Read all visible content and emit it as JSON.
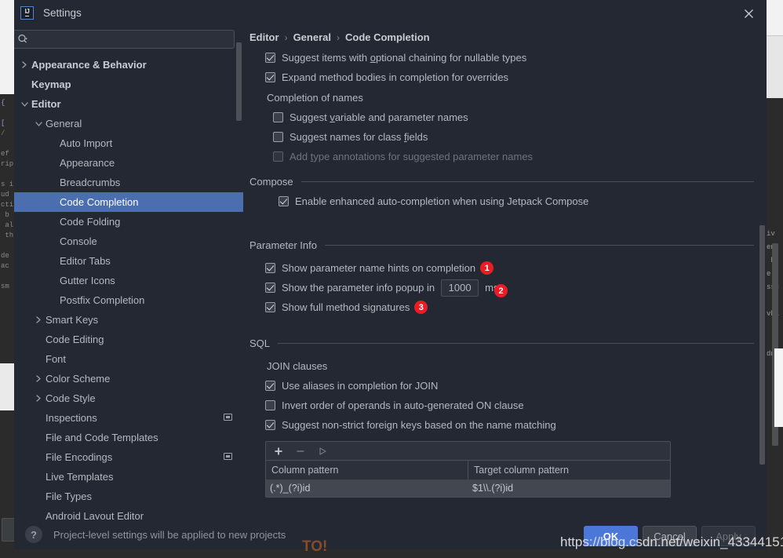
{
  "window": {
    "title": "Settings",
    "logo_text": "IJ",
    "close_icon": "close-icon"
  },
  "search": {
    "value": "",
    "placeholder": "",
    "icon": "search-icon"
  },
  "tree": {
    "items": [
      {
        "label": "Appearance & Behavior",
        "level": 0,
        "twisty": "collapsed",
        "bold": true,
        "selected": false,
        "badge": false
      },
      {
        "label": "Keymap",
        "level": 0,
        "twisty": "none",
        "bold": true,
        "selected": false,
        "badge": false
      },
      {
        "label": "Editor",
        "level": 0,
        "twisty": "expanded",
        "bold": true,
        "selected": false,
        "badge": false
      },
      {
        "label": "General",
        "level": 1,
        "twisty": "expanded",
        "bold": false,
        "selected": false,
        "badge": false
      },
      {
        "label": "Auto Import",
        "level": 2,
        "twisty": "none",
        "bold": false,
        "selected": false,
        "badge": false
      },
      {
        "label": "Appearance",
        "level": 2,
        "twisty": "none",
        "bold": false,
        "selected": false,
        "badge": false
      },
      {
        "label": "Breadcrumbs",
        "level": 2,
        "twisty": "none",
        "bold": false,
        "selected": false,
        "badge": false
      },
      {
        "label": "Code Completion",
        "level": 2,
        "twisty": "none",
        "bold": false,
        "selected": true,
        "badge": false
      },
      {
        "label": "Code Folding",
        "level": 2,
        "twisty": "none",
        "bold": false,
        "selected": false,
        "badge": false
      },
      {
        "label": "Console",
        "level": 2,
        "twisty": "none",
        "bold": false,
        "selected": false,
        "badge": false
      },
      {
        "label": "Editor Tabs",
        "level": 2,
        "twisty": "none",
        "bold": false,
        "selected": false,
        "badge": false
      },
      {
        "label": "Gutter Icons",
        "level": 2,
        "twisty": "none",
        "bold": false,
        "selected": false,
        "badge": false
      },
      {
        "label": "Postfix Completion",
        "level": 2,
        "twisty": "none",
        "bold": false,
        "selected": false,
        "badge": false
      },
      {
        "label": "Smart Keys",
        "level": 1,
        "twisty": "collapsed",
        "bold": false,
        "selected": false,
        "badge": false
      },
      {
        "label": "Code Editing",
        "level": 1,
        "twisty": "none",
        "bold": false,
        "selected": false,
        "badge": false
      },
      {
        "label": "Font",
        "level": 1,
        "twisty": "none",
        "bold": false,
        "selected": false,
        "badge": false
      },
      {
        "label": "Color Scheme",
        "level": 1,
        "twisty": "collapsed",
        "bold": false,
        "selected": false,
        "badge": false
      },
      {
        "label": "Code Style",
        "level": 1,
        "twisty": "collapsed",
        "bold": false,
        "selected": false,
        "badge": false
      },
      {
        "label": "Inspections",
        "level": 1,
        "twisty": "none",
        "bold": false,
        "selected": false,
        "badge": true
      },
      {
        "label": "File and Code Templates",
        "level": 1,
        "twisty": "none",
        "bold": false,
        "selected": false,
        "badge": false
      },
      {
        "label": "File Encodings",
        "level": 1,
        "twisty": "none",
        "bold": false,
        "selected": false,
        "badge": true
      },
      {
        "label": "Live Templates",
        "level": 1,
        "twisty": "none",
        "bold": false,
        "selected": false,
        "badge": false
      },
      {
        "label": "File Types",
        "level": 1,
        "twisty": "none",
        "bold": false,
        "selected": false,
        "badge": false
      },
      {
        "label": "Android Layout Editor",
        "level": 1,
        "twisty": "none",
        "bold": false,
        "selected": false,
        "badge": false
      }
    ]
  },
  "breadcrumb": {
    "part1": "Editor",
    "part2": "General",
    "part3": "Code Completion",
    "separator": "›"
  },
  "content": {
    "top_options": [
      {
        "label_pre": "Suggest items with ",
        "mnemonic": "o",
        "label_post": "ptional chaining for nullable types",
        "checked": true,
        "disabled": false
      },
      {
        "label_pre": "Expand method bodies in completion for overrides",
        "mnemonic": "",
        "label_post": "",
        "checked": true,
        "disabled": false
      }
    ],
    "completion_of_names": {
      "title": "Completion of names",
      "options": [
        {
          "label_pre": "Suggest ",
          "mnemonic": "v",
          "label_post": "ariable and parameter names",
          "checked": false,
          "disabled": false
        },
        {
          "label_pre": "Suggest names for class ",
          "mnemonic": "f",
          "label_post": "ields",
          "checked": false,
          "disabled": false
        },
        {
          "label_pre": "Add ",
          "mnemonic": "t",
          "label_post": "ype annotations for suggested parameter names",
          "checked": false,
          "disabled": true
        }
      ]
    },
    "compose": {
      "title": "Compose",
      "options": [
        {
          "label_pre": "Enable enhanced auto-completion when using Jetpack Compose",
          "mnemonic": "",
          "label_post": "",
          "checked": true,
          "disabled": false
        }
      ]
    },
    "parameter_info": {
      "title": "Parameter Info",
      "opt1_label": "Show parameter name hints on completion",
      "opt1_checked": true,
      "opt1_badge": "1",
      "opt2_label": "Show the parameter info popup in",
      "opt2_checked": true,
      "opt2_value": "1000",
      "opt2_unit": "ms",
      "opt2_badge": "2",
      "opt3_label": "Show full method signatures",
      "opt3_checked": true,
      "opt3_badge": "3"
    },
    "sql": {
      "title": "SQL",
      "join_title": "JOIN clauses",
      "options": [
        {
          "label": "Use aliases in completion for JOIN",
          "checked": true
        },
        {
          "label": "Invert order of operands in auto-generated ON clause",
          "checked": false
        },
        {
          "label": "Suggest non-strict foreign keys based on the name matching",
          "checked": true
        }
      ],
      "toolbar": {
        "add": "+",
        "remove": "−",
        "run": "▸"
      },
      "table": {
        "headers": [
          "Column pattern",
          "Target column pattern"
        ],
        "rows": [
          [
            "(.*)_(?i)id",
            "$1\\\\.(?i)id"
          ]
        ]
      }
    }
  },
  "footer": {
    "help_icon": "question-mark-icon",
    "hint": "Project-level settings will be applied to new projects",
    "buttons": [
      {
        "label": "OK",
        "style": "primary"
      },
      {
        "label": "Cancel",
        "style": "normal"
      },
      {
        "label": "Apply",
        "style": "muted"
      }
    ]
  },
  "watermark": {
    "text": "https://blog.csdn.net/weixin_43344151"
  },
  "colors": {
    "dialog_bg": "#242832",
    "selection_blue": "#4b6eaf",
    "primary_button": "#4b78d8",
    "badge_red": "#ed1c24",
    "text": "#b4b8bf"
  }
}
